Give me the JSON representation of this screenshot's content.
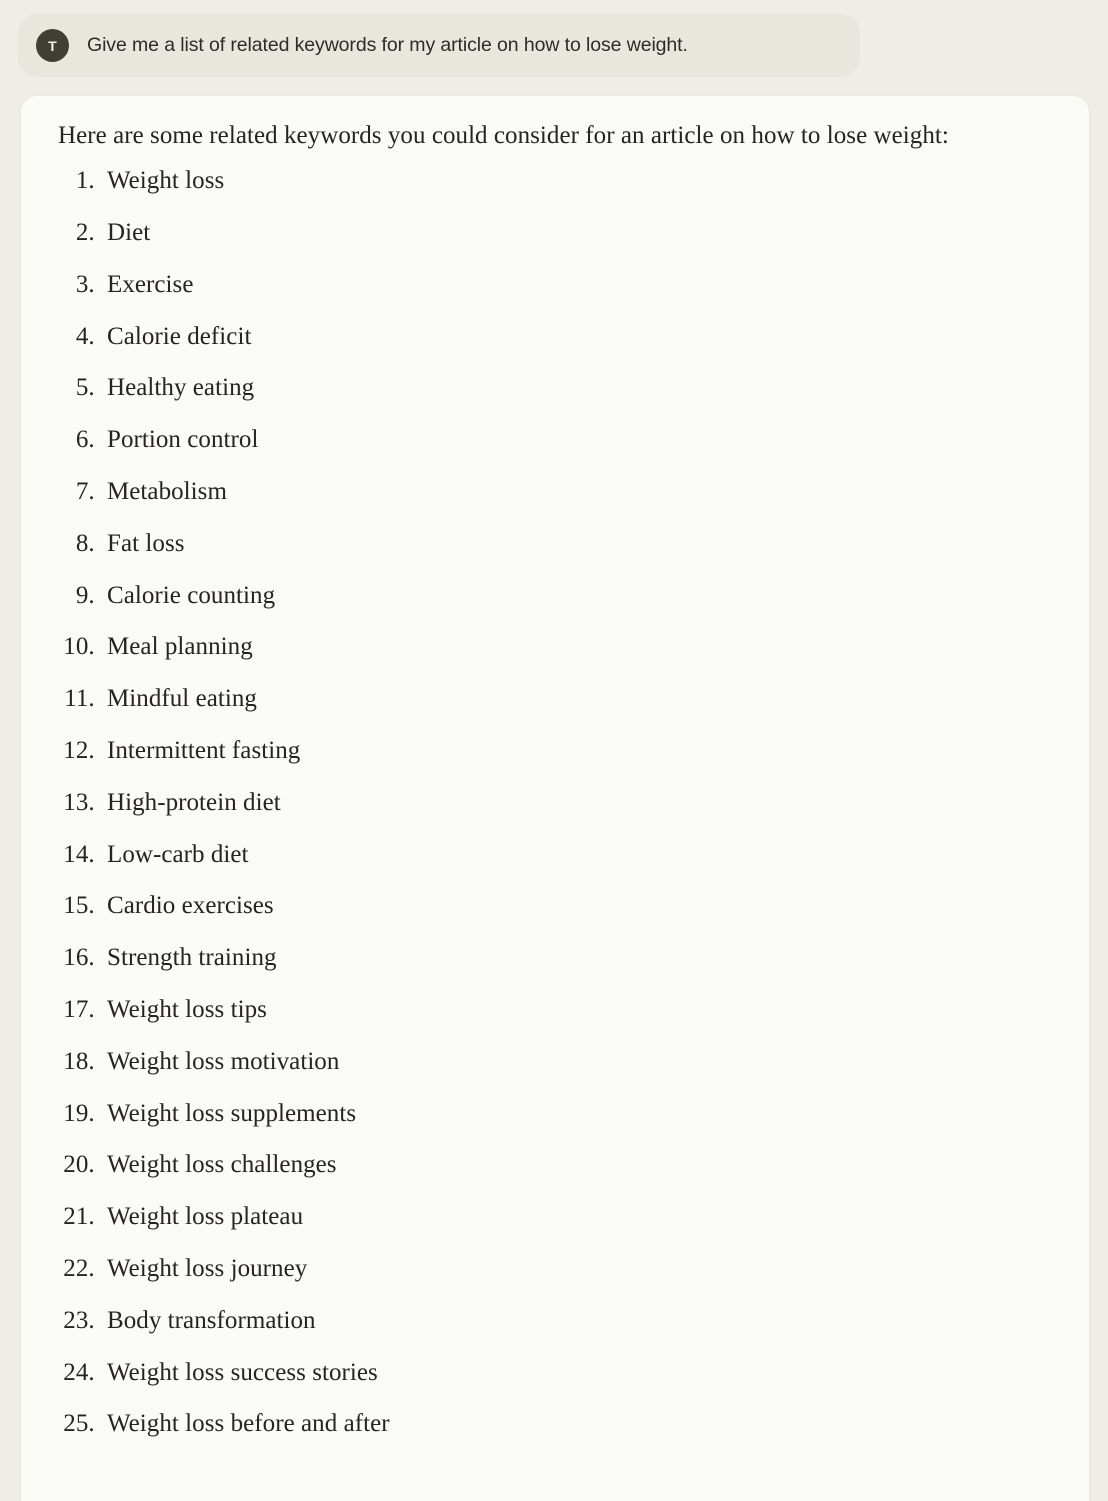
{
  "theme": {
    "page_background": "#efeee6",
    "user_bubble_background": "#e9e7dd",
    "assistant_card_background": "#fafaf7",
    "text_color": "#26241e",
    "avatar_background": "#413f33",
    "avatar_text_color": "#f4f3ee"
  },
  "conversation": {
    "user_turn": {
      "avatar_initial": "T",
      "message": "Give me a list of related keywords for my article on how to lose weight."
    },
    "assistant_turn": {
      "intro": "Here are some related keywords you could consider for an article on how to lose weight:",
      "keywords": [
        "Weight loss",
        "Diet",
        "Exercise",
        "Calorie deficit",
        "Healthy eating",
        "Portion control",
        "Metabolism",
        "Fat loss",
        "Calorie counting",
        "Meal planning",
        "Mindful eating",
        "Intermittent fasting",
        "High-protein diet",
        "Low-carb diet",
        "Cardio exercises",
        "Strength training",
        "Weight loss tips",
        "Weight loss motivation",
        "Weight loss supplements",
        "Weight loss challenges",
        "Weight loss plateau",
        "Weight loss journey",
        "Body transformation",
        "Weight loss success stories",
        "Weight loss before and after"
      ]
    }
  }
}
